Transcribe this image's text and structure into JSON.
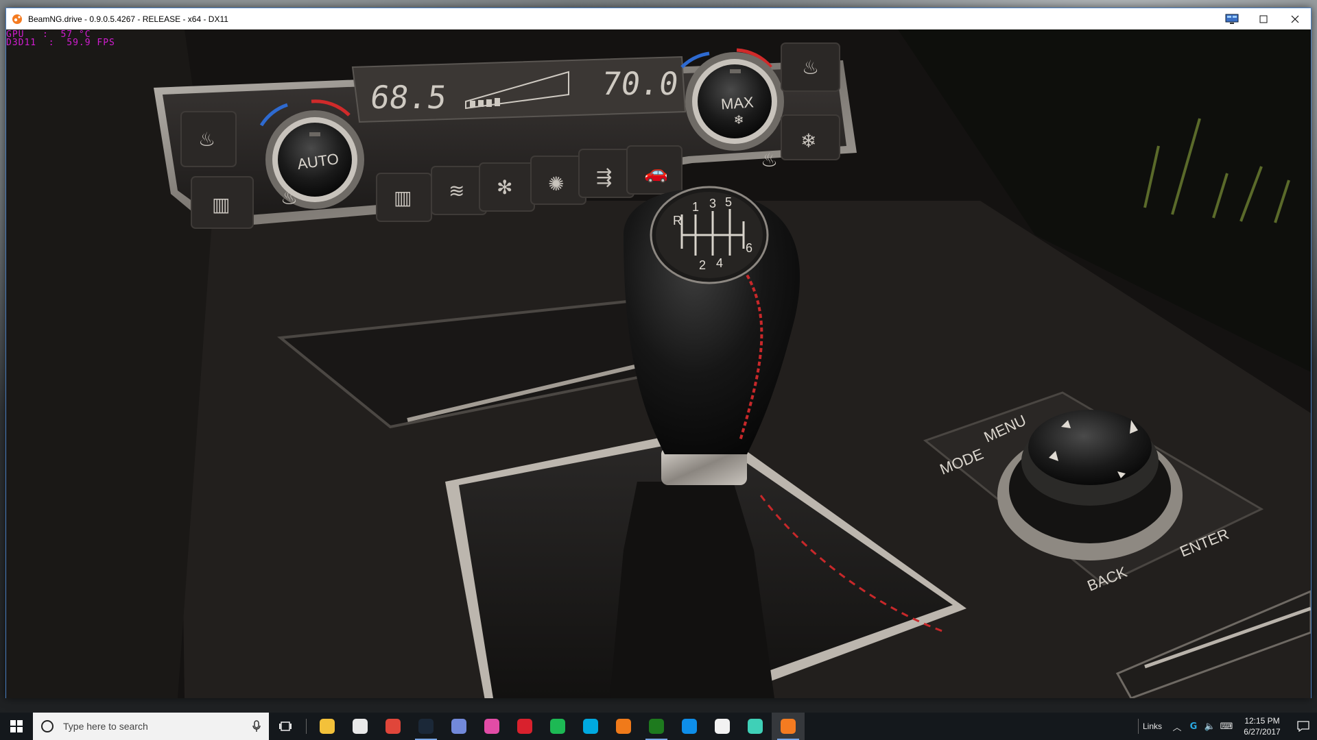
{
  "window": {
    "title": "BeamNG.drive - 0.9.0.5.4267 - RELEASE - x64 - DX11",
    "controls": {
      "maximize_icon": "maximize-icon",
      "close_icon": "close-icon",
      "monitor_icon": "monitor-icon"
    }
  },
  "overlay": {
    "gpu_line": "GPU   :  57 °C",
    "fps_line": "D3D11  :  59.9 FPS"
  },
  "scene": {
    "climate": {
      "temp_left": "68.5",
      "temp_right": "70.0",
      "knob_left": "AUTO",
      "knob_right": "MAX"
    },
    "shifter_pattern": {
      "top": [
        "R",
        "1",
        "3",
        "5"
      ],
      "bottom": [
        "2",
        "4",
        "6"
      ]
    },
    "controller": {
      "mode": "MODE",
      "menu": "MENU",
      "back": "BACK",
      "enter": "ENTER"
    }
  },
  "taskbar": {
    "search_placeholder": "Type here to search",
    "apps": [
      {
        "name": "file-explorer-icon",
        "color": "#f3c13a"
      },
      {
        "name": "store-icon",
        "color": "#e9e9e9"
      },
      {
        "name": "chrome-icon",
        "color": "#e0463a"
      },
      {
        "name": "steam-icon",
        "color": "#1b2838"
      },
      {
        "name": "discord-icon",
        "color": "#7289da"
      },
      {
        "name": "paint-3d-icon",
        "color": "#e24ca6"
      },
      {
        "name": "red-app-icon",
        "color": "#d9212d"
      },
      {
        "name": "spotify-icon",
        "color": "#1db954"
      },
      {
        "name": "logitech-icon",
        "color": "#00a9e0"
      },
      {
        "name": "blender-icon",
        "color": "#f07a1a"
      },
      {
        "name": "xbox-icon",
        "color": "#1e7a1e"
      },
      {
        "name": "teamviewer-icon",
        "color": "#0e8ee9"
      },
      {
        "name": "mail-icon",
        "color": "#f2f2f2"
      },
      {
        "name": "razer-icon",
        "color": "#3fd0b7"
      },
      {
        "name": "beamng-icon",
        "color": "#f47b20"
      }
    ],
    "tray_links": "Links",
    "time": "12:15 PM",
    "date": "6/27/2017"
  }
}
